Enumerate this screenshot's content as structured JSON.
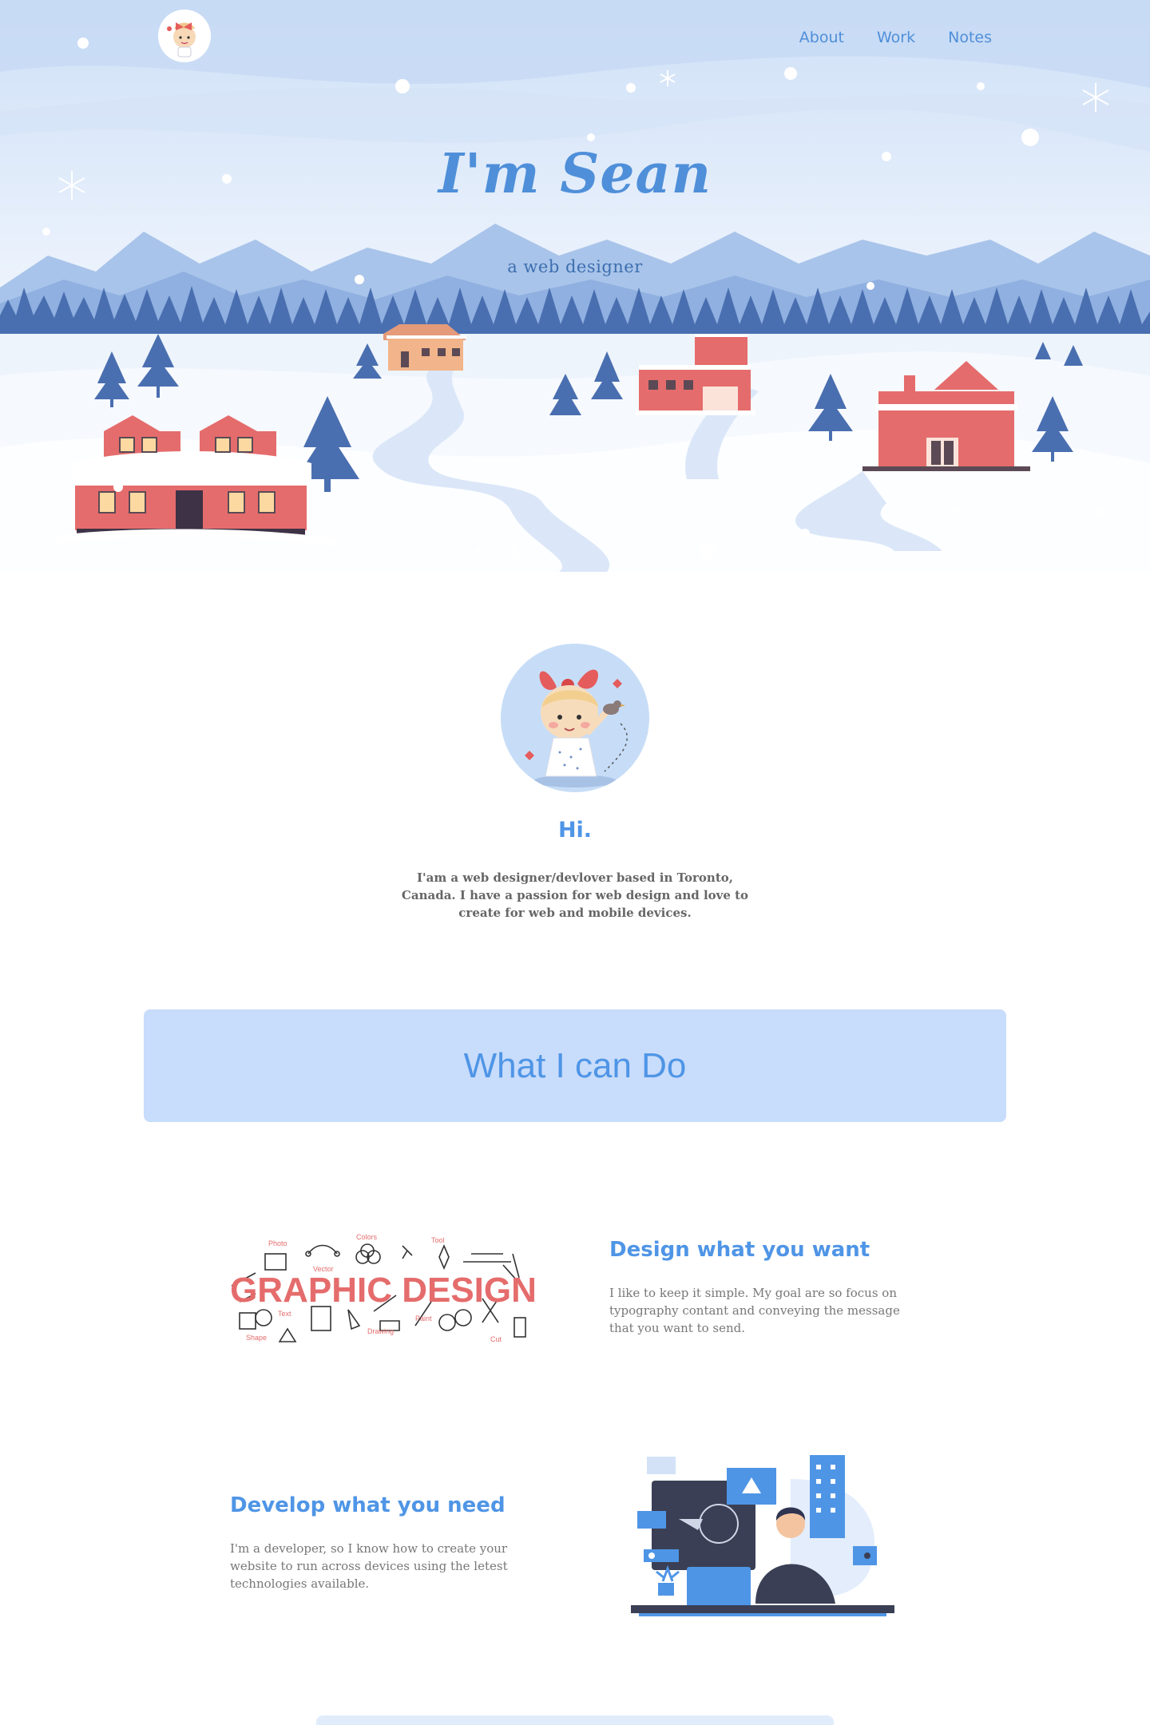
{
  "nav": {
    "items": [
      {
        "label": "About"
      },
      {
        "label": "Work"
      },
      {
        "label": "Notes"
      }
    ]
  },
  "hero": {
    "title": "I'm Sean",
    "subtitle": "a web designer"
  },
  "about": {
    "heading": "Hi.",
    "text": "I'am a web designer/devlover based in Toronto, Canada. I have a passion for web design and love to create for web and mobile devices."
  },
  "cando": {
    "heading": "What I can Do"
  },
  "services": [
    {
      "title": "Design what you want",
      "text": "I like to keep it simple. My goal are so focus on typography contant and conveying the message that you want to send."
    },
    {
      "title": "Develop what you need",
      "text": "I'm a developer, so I know how to create your website to run across devices using the letest technologies available."
    }
  ],
  "graphic_design_art": {
    "headline": "GRAPHIC DESIGN",
    "labels": [
      "Photo",
      "Vector",
      "Colors",
      "Tool",
      "Text",
      "Shape",
      "Drawing",
      "Paint",
      "Cut"
    ]
  },
  "colors": {
    "accent": "#4f95e6",
    "banner": "#c8dcfb",
    "house": "#e56c6c"
  }
}
